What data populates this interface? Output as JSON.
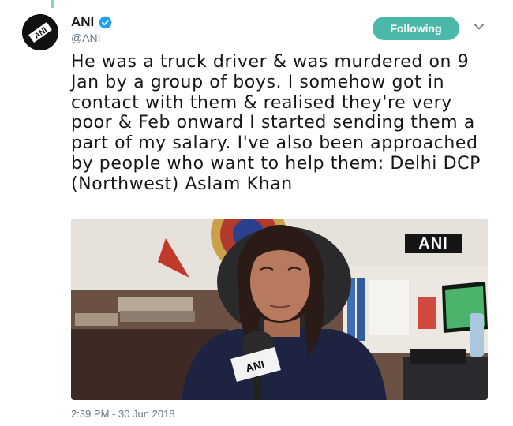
{
  "tweet": {
    "author_name": "ANI",
    "author_handle": "@ANI",
    "follow_label": "Following",
    "text": "He was a truck driver & was murdered on 9 Jan by a group of boys. I somehow got in contact with them & realised they're very poor & Feb onward I started sending them a part of my salary. I've also been approached by people who want to help them: Delhi DCP (Northwest) Aslam Khan",
    "media_watermark": "ANI",
    "mic_label": "ANI",
    "timestamp": "2:39 PM - 30 Jun 2018"
  },
  "icons": {
    "verified": "verified-badge-icon",
    "menu": "chevron-down-icon"
  },
  "colors": {
    "follow_button": "#4cb9a8",
    "verified": "#1da1f2",
    "secondary_text": "#657786"
  }
}
